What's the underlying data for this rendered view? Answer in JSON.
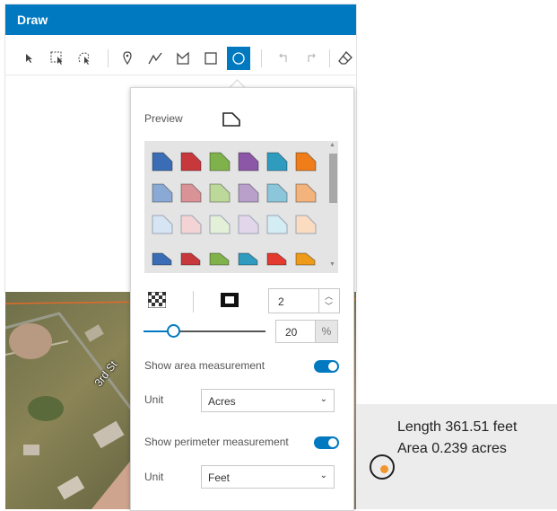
{
  "widget": {
    "title": "Draw"
  },
  "toolbar": {
    "tools": [
      {
        "name": "select-tool",
        "icon": "arrow-cursor-icon"
      },
      {
        "name": "box-select-tool",
        "icon": "marquee-select-icon"
      },
      {
        "name": "lasso-select-tool",
        "icon": "lasso-select-icon"
      },
      {
        "name": "point-tool",
        "icon": "pin-icon"
      },
      {
        "name": "polyline-tool",
        "icon": "polyline-icon"
      },
      {
        "name": "polygon-tool",
        "icon": "polygon-icon"
      },
      {
        "name": "rectangle-tool",
        "icon": "rectangle-icon"
      },
      {
        "name": "circle-tool",
        "icon": "circle-icon",
        "active": true
      },
      {
        "name": "undo-tool",
        "icon": "undo-icon"
      },
      {
        "name": "redo-tool",
        "icon": "redo-icon"
      },
      {
        "name": "clear-tool",
        "icon": "eraser-icon"
      }
    ]
  },
  "symbol_panel": {
    "preview_label": "Preview",
    "swatch_rows": [
      [
        "#3a6db5",
        "#c7383d",
        "#7fb24a",
        "#8c57a6",
        "#2f9bbf",
        "#ee7d1a"
      ],
      [
        "#8aa9d4",
        "#d99396",
        "#bcd89b",
        "#b9a0cb",
        "#8cc6da",
        "#f2b37c"
      ],
      [
        "#d7e4f3",
        "#f4d3d4",
        "#e4efd7",
        "#e2d6ea",
        "#d4ecf3",
        "#fbdcc1"
      ],
      [
        "#3a6db5",
        "#c7383d",
        "#7fb24a",
        "#2f9bbf",
        "#e3392e",
        "#ee9a1a"
      ]
    ],
    "outline_width": "2",
    "transparency": "20",
    "transparency_unit": "%",
    "show_area_label": "Show area measurement",
    "area_unit_label": "Unit",
    "area_unit": "Acres",
    "show_perimeter_label": "Show perimeter measurement",
    "perimeter_unit_label": "Unit",
    "perimeter_unit": "Feet",
    "show_area": true,
    "show_perimeter": true
  },
  "map": {
    "road_label": "3rd St"
  },
  "legend": {
    "length_text": "Length 361.51 feet",
    "area_text": "Area 0.239 acres",
    "point_color": "#f0962d"
  }
}
